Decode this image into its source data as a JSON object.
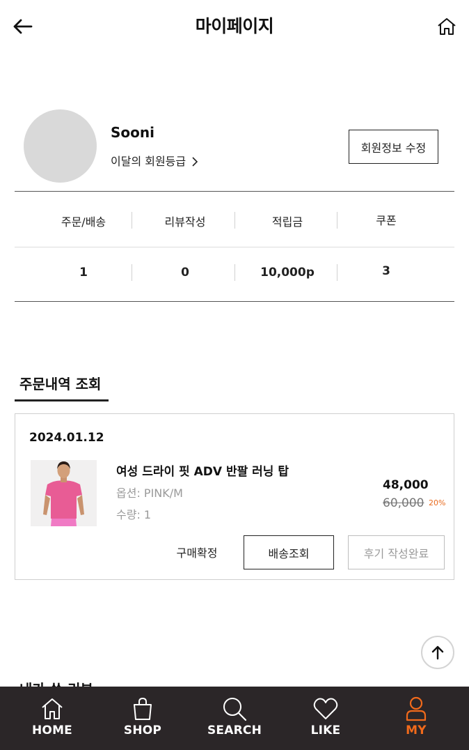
{
  "header": {
    "title": "마이페이지",
    "back_icon": "arrow-left-icon",
    "home_icon": "home-icon"
  },
  "profile": {
    "name": "Sooni",
    "grade_link": "이달의 회원등급",
    "edit_button": "회원정보 수정"
  },
  "stats": [
    {
      "label": "주문/배송",
      "value": "1"
    },
    {
      "label": "리뷰작성",
      "value": "0"
    },
    {
      "label": "적립금",
      "value": "10,000p"
    },
    {
      "label": "쿠폰",
      "value": "3"
    }
  ],
  "orders": {
    "section_title": "주문내역 조회",
    "items": [
      {
        "date": "2024.01.12",
        "product_name": "여성 드라이 핏 ADV 반팔 러닝 탑",
        "option": "옵션: PINK/M",
        "quantity": "수량: 1",
        "price": "48,000",
        "original_price": "60,000",
        "discount": "20%",
        "actions": {
          "confirm": "구매확정",
          "track": "배송조회",
          "review": "후기 작성완료"
        }
      }
    ]
  },
  "next_section": {
    "title": "내가 쓴 리뷰"
  },
  "bottom_nav": {
    "active": "MY",
    "items": [
      {
        "label": "HOME",
        "icon": "home-icon"
      },
      {
        "label": "SHOP",
        "icon": "shopping-bag-icon"
      },
      {
        "label": "SEARCH",
        "icon": "search-icon"
      },
      {
        "label": "LIKE",
        "icon": "heart-icon"
      },
      {
        "label": "MY",
        "icon": "user-icon"
      }
    ]
  },
  "colors": {
    "accent": "#f26a1b",
    "nav_background": "#2b2628",
    "avatar_placeholder": "#d9d9d9"
  }
}
